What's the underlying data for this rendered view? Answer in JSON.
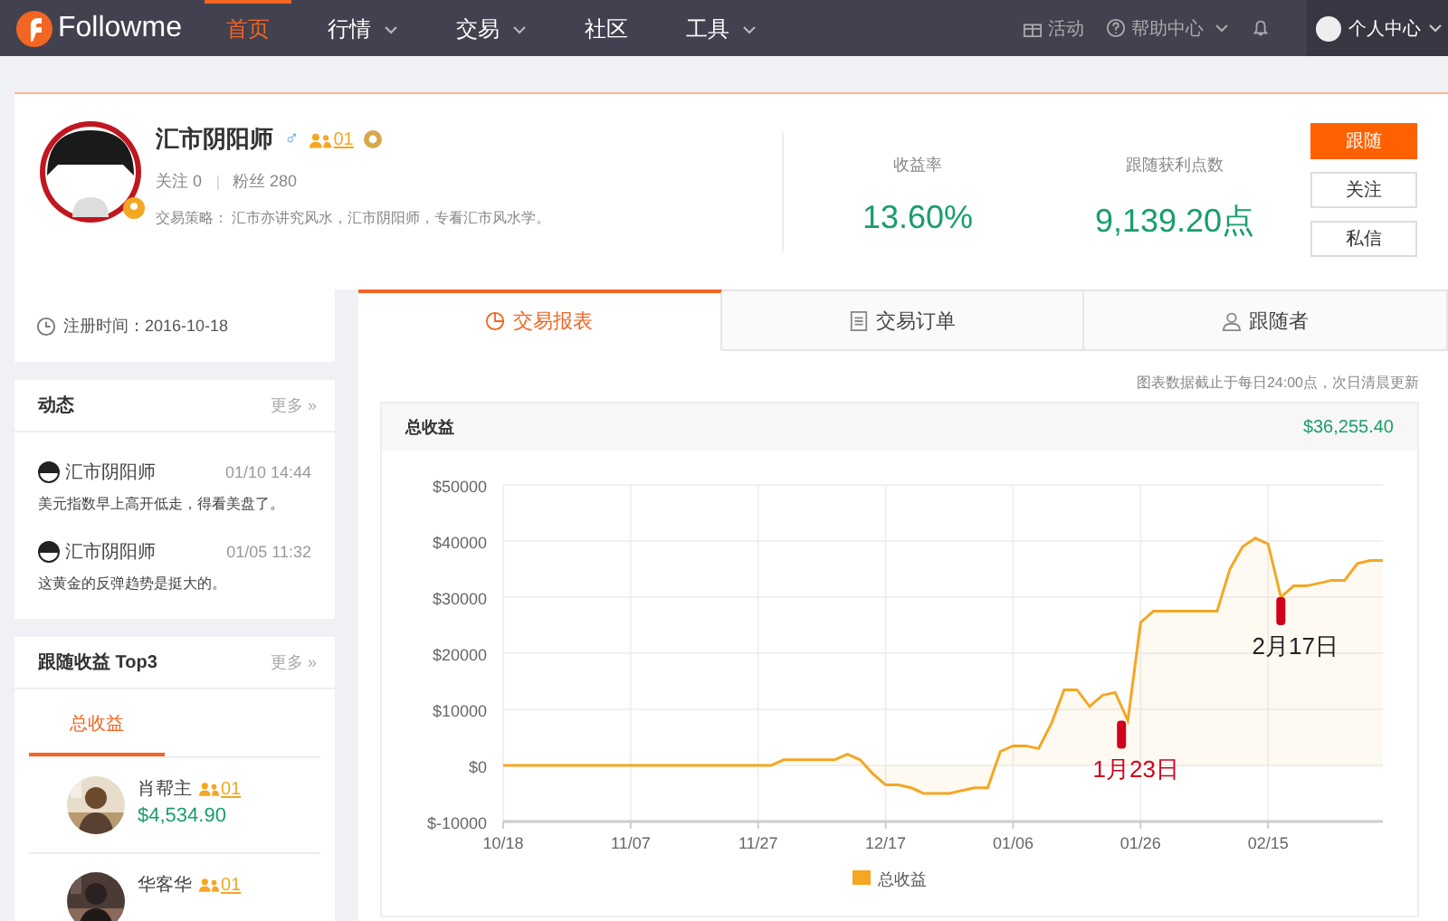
{
  "nav": {
    "logo": "Followme",
    "items": [
      {
        "label": "首页",
        "selected": true,
        "dropdown": false
      },
      {
        "label": "行情",
        "selected": false,
        "dropdown": true
      },
      {
        "label": "交易",
        "selected": false,
        "dropdown": true
      },
      {
        "label": "社区",
        "selected": false,
        "dropdown": false
      },
      {
        "label": "工具",
        "selected": false,
        "dropdown": true
      }
    ],
    "activity": "活动",
    "help": "帮助中心",
    "user": "个人中心"
  },
  "profile": {
    "name": "汇市阴阳师",
    "gender": "♂",
    "badge": "01",
    "counts": [
      {
        "label": "关注",
        "value": "0"
      },
      {
        "label": "粉丝",
        "value": "280"
      }
    ],
    "strategy_label": "交易策略：",
    "strategy": "汇市亦讲究风水，汇市阴阳师，专看汇市风水学。",
    "stats": [
      {
        "label": "收益率",
        "value": "13.60%"
      },
      {
        "label": "跟随获利点数",
        "value": "9,139.20点"
      }
    ],
    "buttons": [
      {
        "label": "跟随",
        "primary": true
      },
      {
        "label": "关注",
        "primary": false
      },
      {
        "label": "私信",
        "primary": false
      }
    ]
  },
  "sidebar": {
    "registered": "注册时间：2016-10-18",
    "feed": {
      "title": "动态",
      "more": "更多 »",
      "posts": [
        {
          "author": "汇市阴阳师",
          "time": "01/10 14:44",
          "text": "美元指数早上高开低走，得看美盘了。"
        },
        {
          "author": "汇市阴阳师",
          "time": "01/05 11:32",
          "text": "这黄金的反弹趋势是挺大的。"
        }
      ]
    },
    "top3": {
      "title": "跟随收益 Top3",
      "more": "更多 »",
      "tabs": [
        {
          "label": "总收益",
          "selected": true
        }
      ],
      "entries": [
        {
          "name": "肖帮主",
          "badge": "01",
          "amount": "$4,534.90"
        },
        {
          "name": "华客华",
          "badge": "01"
        }
      ]
    }
  },
  "tabs": [
    {
      "label": "交易报表",
      "kind": "report",
      "selected": true
    },
    {
      "label": "交易订单",
      "kind": "orders",
      "selected": false
    },
    {
      "label": "跟随者",
      "kind": "followers",
      "selected": false
    }
  ],
  "note": "图表数据截止于每日24:00点，次日清晨更新",
  "card": {
    "title": "总收益",
    "total": "$36,255.40",
    "chart_data": {
      "type": "area",
      "grid": true,
      "ylim": [
        -10000,
        50000
      ],
      "categories": [
        "10/18",
        null,
        null,
        null,
        null,
        null,
        null,
        null,
        null,
        null,
        "11/07",
        null,
        null,
        null,
        null,
        null,
        null,
        null,
        null,
        null,
        "11/27",
        null,
        null,
        null,
        null,
        null,
        null,
        null,
        null,
        null,
        "12/17",
        null,
        null,
        null,
        null,
        null,
        null,
        null,
        null,
        null,
        "01/06",
        null,
        null,
        null,
        null,
        null,
        null,
        null,
        null,
        null,
        "01/26",
        null,
        null,
        null,
        null,
        null,
        null,
        null,
        null,
        null,
        "02/15",
        null,
        null,
        null,
        null,
        null,
        null,
        null,
        null,
        null
      ],
      "yticks": [
        {
          "value": -10000,
          "label": "$-10000"
        },
        {
          "value": 0,
          "label": "$0"
        },
        {
          "value": 10000,
          "label": "$10000"
        },
        {
          "value": 20000,
          "label": "$20000"
        },
        {
          "value": 30000,
          "label": "$30000"
        },
        {
          "value": 40000,
          "label": "$40000"
        },
        {
          "value": 50000,
          "label": "$50000"
        }
      ],
      "series": [
        {
          "name": "总收益",
          "color": "#f5a623",
          "values": [
            0,
            0,
            0,
            0,
            0,
            0,
            0,
            0,
            0,
            0,
            0,
            0,
            0,
            0,
            0,
            0,
            0,
            0,
            0,
            0,
            0,
            0,
            1000,
            1000,
            1000,
            1000,
            1000,
            2000,
            1000,
            -1500,
            -3500,
            -3500,
            -4000,
            -5000,
            -5000,
            -5000,
            -4500,
            -4000,
            -4000,
            2500,
            3500,
            3500,
            3000,
            7500,
            13500,
            13500,
            10500,
            12500,
            13000,
            8000,
            25500,
            27500,
            27500,
            27500,
            27500,
            27500,
            27500,
            35000,
            39000,
            40500,
            39500,
            30000,
            32000,
            32000,
            32500,
            33000,
            33000,
            36000,
            36500,
            36500
          ]
        }
      ],
      "annotations": [
        "1月23日",
        "2月17日"
      ]
    }
  }
}
